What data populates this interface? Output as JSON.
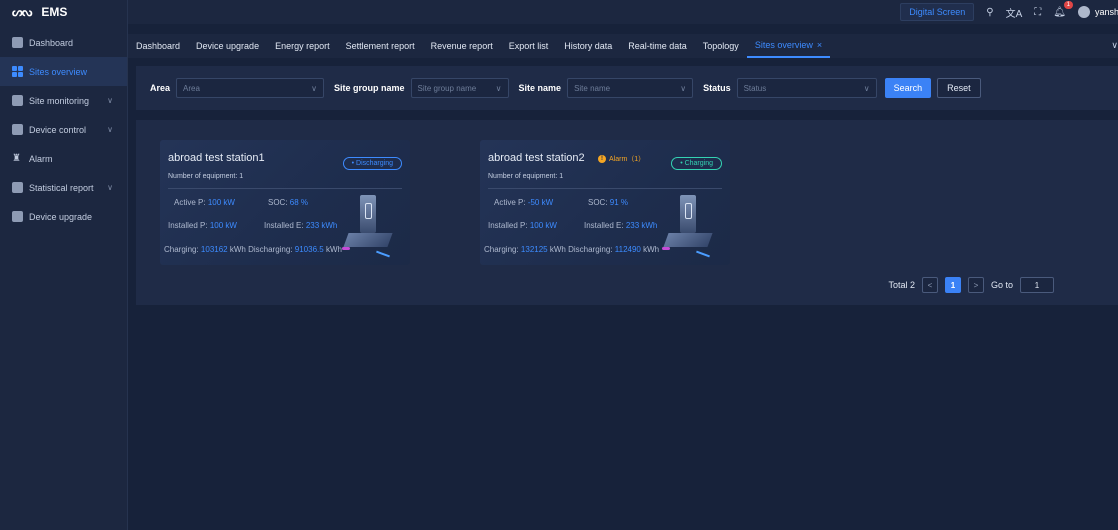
{
  "app": {
    "title": "EMS"
  },
  "header": {
    "digital_screen": "Digital Screen",
    "notification_count": "1",
    "user_name": "yansh"
  },
  "sidebar": {
    "items": [
      {
        "label": "Dashboard"
      },
      {
        "label": "Sites overview",
        "active": true
      },
      {
        "label": "Site monitoring",
        "expandable": true
      },
      {
        "label": "Device control",
        "expandable": true
      },
      {
        "label": "Alarm"
      },
      {
        "label": "Statistical report",
        "expandable": true
      },
      {
        "label": "Device upgrade"
      }
    ]
  },
  "tabs": [
    {
      "label": "Dashboard"
    },
    {
      "label": "Device upgrade"
    },
    {
      "label": "Energy report"
    },
    {
      "label": "Settlement report"
    },
    {
      "label": "Revenue report"
    },
    {
      "label": "Export list"
    },
    {
      "label": "History data"
    },
    {
      "label": "Real-time data"
    },
    {
      "label": "Topology"
    },
    {
      "label": "Sites overview",
      "active": true,
      "close": "×"
    }
  ],
  "filter": {
    "area_label": "Area",
    "area_placeholder": "Area",
    "group_label": "Site group name",
    "group_placeholder": "Site group name",
    "site_label": "Site name",
    "site_placeholder": "Site name",
    "status_label": "Status",
    "status_placeholder": "Status",
    "search": "Search",
    "reset": "Reset"
  },
  "sites": [
    {
      "name": "abroad test station1",
      "count_label": "Number of equipment:",
      "count": "1",
      "status": "• Discharging",
      "active_p_label": "Active P:",
      "active_p": "100 kW",
      "soc_label": "SOC:",
      "soc": "68 %",
      "installed_p_label": "Installed P:",
      "installed_p": "100 kW",
      "installed_e_label": "Installed E:",
      "installed_e": "233 kWh",
      "charging_label": "Charging:",
      "charging": "103162",
      "discharging_label": "kWh Discharging:",
      "discharging": "91036.5",
      "unit": "kWh"
    },
    {
      "name": "abroad test station2",
      "alarm": "Alarm（1）",
      "count_label": "Number of equipment:",
      "count": "1",
      "status": "• Charging",
      "active_p_label": "Active P:",
      "active_p": "-50 kW",
      "soc_label": "SOC:",
      "soc": "91 %",
      "installed_p_label": "Installed P:",
      "installed_p": "100 kW",
      "installed_e_label": "Installed E:",
      "installed_e": "233 kWh",
      "charging_label": "Charging:",
      "charging": "132125",
      "discharging_label": "kWh Discharging:",
      "discharging": "112490",
      "unit": "kWh"
    }
  ],
  "pagination": {
    "total": "Total 2",
    "prev": "<",
    "current": "1",
    "next": ">",
    "goto_label": "Go to",
    "goto_value": "1"
  },
  "colors": {
    "accent": "#3b82f6",
    "charging": "#34d3b3",
    "alarm": "#f5a623",
    "background": "#17223a"
  }
}
